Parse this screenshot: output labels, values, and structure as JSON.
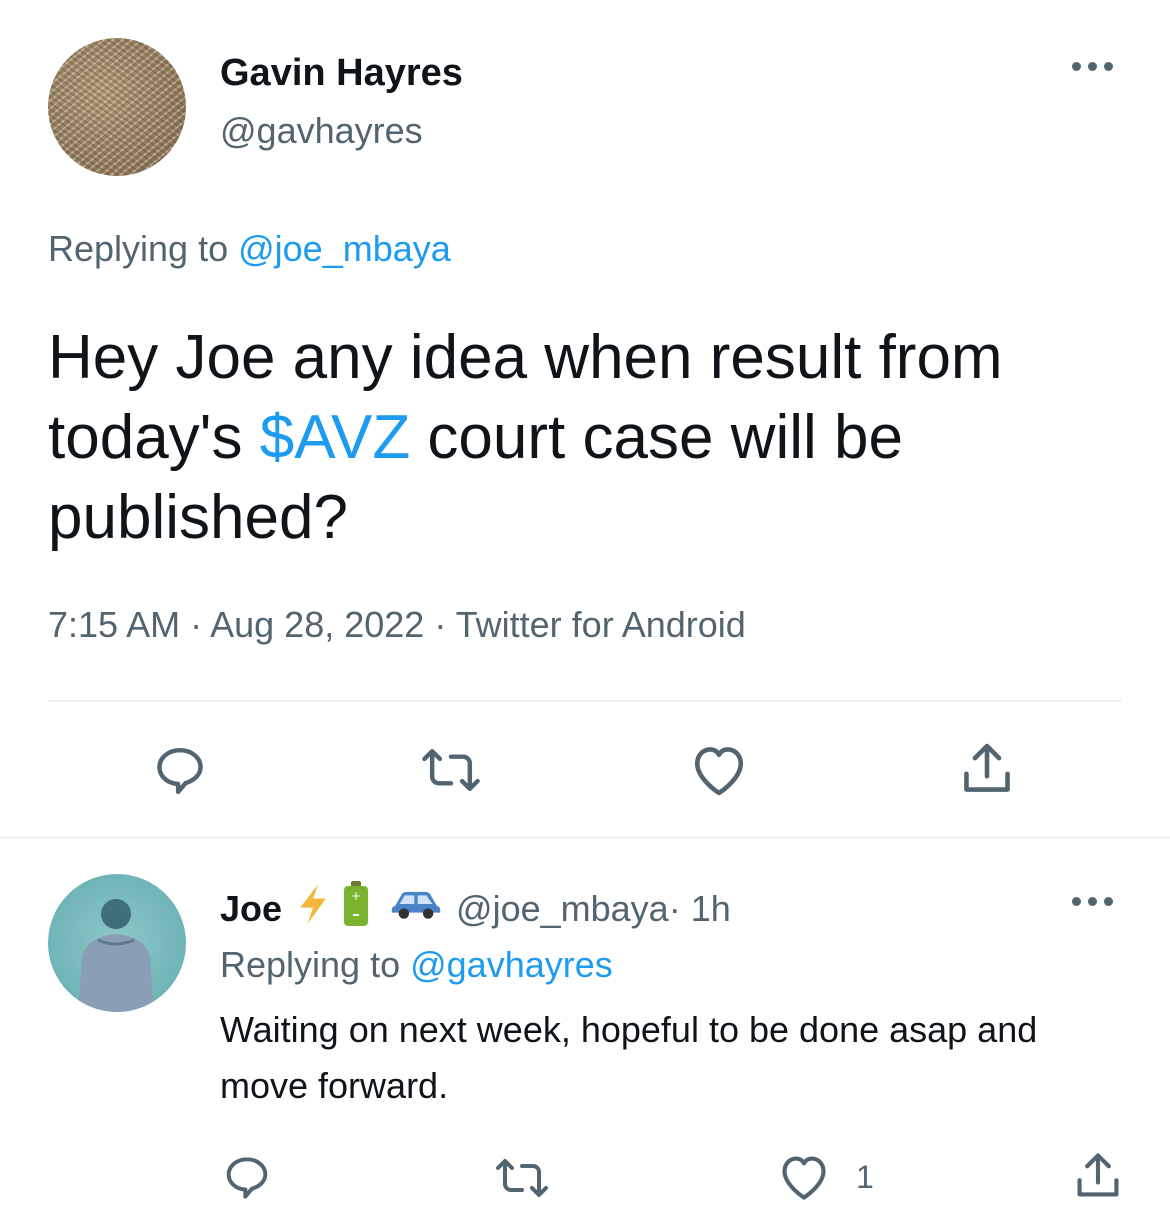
{
  "main_tweet": {
    "author_name": "Gavin Hayres",
    "author_handle": "@gavhayres",
    "replying_prefix": "Replying to ",
    "replying_handle": "@joe_mbaya",
    "text_before": "Hey Joe any idea when result from today's ",
    "cashtag": "$AVZ",
    "text_after": " court case will be published?",
    "time": "7:15 AM",
    "sep": " · ",
    "date": "Aug 28, 2022",
    "source": "Twitter for Android"
  },
  "reply_tweet": {
    "author_name": "Joe",
    "emojis": [
      "lightning-emoji",
      "battery-emoji",
      "car-emoji"
    ],
    "author_handle": "@joe_mbaya",
    "time_ago": " · 1h",
    "replying_prefix": "Replying to ",
    "replying_handle": "@gavhayres",
    "text": "Waiting on next week, hopeful to be done asap and move forward.",
    "like_count": "1"
  },
  "colors": {
    "link": "#1d9bf0",
    "secondary_text": "#536471",
    "primary_text": "#0f1419",
    "divider": "#eff3f4"
  }
}
